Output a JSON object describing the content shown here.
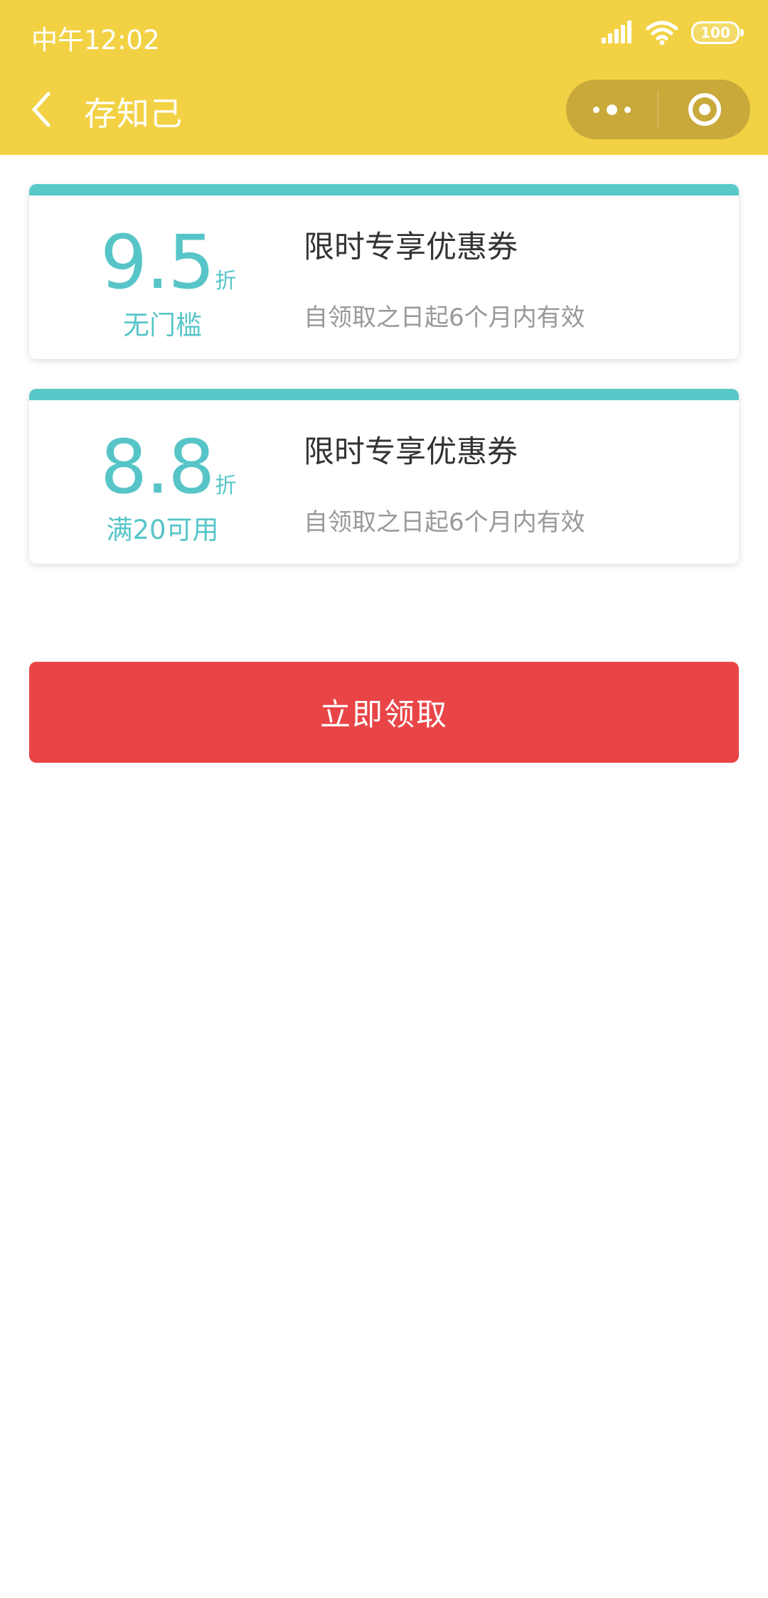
{
  "status_bar": {
    "time": "中午12:02",
    "battery": "100"
  },
  "nav": {
    "title": "存知己"
  },
  "coupons": [
    {
      "discount": "9.5",
      "unit": "折",
      "condition": "无门槛",
      "title": "限时专享优惠券",
      "validity": "自领取之日起6个月内有效"
    },
    {
      "discount": "8.8",
      "unit": "折",
      "condition": "满20可用",
      "title": "限时专享优惠券",
      "validity": "自领取之日起6个月内有效"
    }
  ],
  "claim_button": {
    "label": "立即领取"
  },
  "colors": {
    "header": "#F2D244",
    "accent": "#57C5C8",
    "button": "#E94547"
  }
}
